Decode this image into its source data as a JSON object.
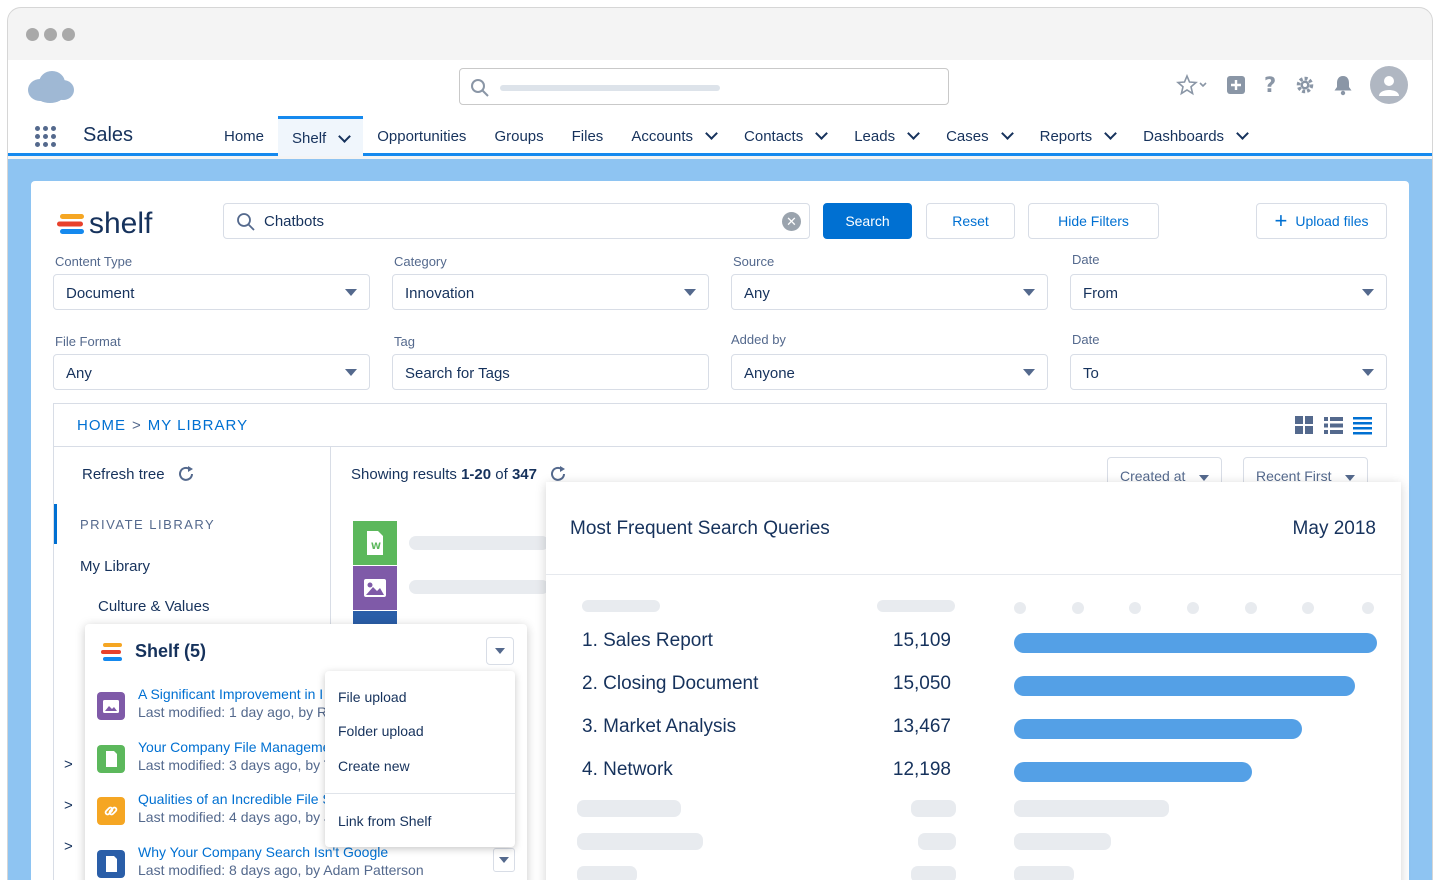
{
  "header": {
    "app_name": "Sales"
  },
  "nav": {
    "items": [
      {
        "label": "Home",
        "dropdown": false,
        "active": false
      },
      {
        "label": "Shelf",
        "dropdown": true,
        "active": true
      },
      {
        "label": "Opportunities",
        "dropdown": false,
        "active": false
      },
      {
        "label": "Groups",
        "dropdown": false,
        "active": false
      },
      {
        "label": "Files",
        "dropdown": false,
        "active": false
      },
      {
        "label": "Accounts",
        "dropdown": true,
        "active": false
      },
      {
        "label": "Contacts",
        "dropdown": true,
        "active": false
      },
      {
        "label": "Leads",
        "dropdown": true,
        "active": false
      },
      {
        "label": "Cases",
        "dropdown": true,
        "active": false
      },
      {
        "label": "Reports",
        "dropdown": true,
        "active": false
      },
      {
        "label": "Dashboards",
        "dropdown": true,
        "active": false
      }
    ]
  },
  "shelf": {
    "logo_text": "shelf",
    "search_value": "Chatbots",
    "search_button": "Search",
    "reset_button": "Reset",
    "hide_filters_button": "Hide Filters",
    "upload_button": "Upload files"
  },
  "filters": {
    "content_type": {
      "label": "Content Type",
      "value": "Document"
    },
    "category": {
      "label": "Category",
      "value": "Innovation"
    },
    "source": {
      "label": "Source",
      "value": "Any"
    },
    "date_from": {
      "label": "Date",
      "value": "From"
    },
    "file_format": {
      "label": "File Format",
      "value": "Any"
    },
    "tag": {
      "label": "Tag",
      "placeholder": "Search for Tags"
    },
    "added_by": {
      "label": "Added by",
      "value": "Anyone"
    },
    "date_to": {
      "label": "Date",
      "value": "To"
    }
  },
  "breadcrumb": {
    "home": "HOME",
    "separator": ">",
    "current": "MY LIBRARY"
  },
  "tree": {
    "refresh": "Refresh tree",
    "section": "PRIVATE LIBRARY",
    "my_library": "My Library",
    "culture": "Culture & Values"
  },
  "results": {
    "showing_prefix": "Showing results ",
    "range": "1-20",
    "of_text": " of ",
    "total": "347",
    "sort_field": "Created at",
    "sort_order": "Recent First"
  },
  "stats": {
    "title": "Most Frequent Search Queries",
    "date": "May 2018",
    "max": 16000,
    "rows": [
      {
        "label": "1. Sales Report",
        "value": "15,109",
        "num": 15109
      },
      {
        "label": "2. Closing Document",
        "value": "15,050",
        "num": 14200
      },
      {
        "label": "3. Market Analysis",
        "value": "13,467",
        "num": 12000
      },
      {
        "label": "4. Network",
        "value": "12,198",
        "num": 9900
      }
    ]
  },
  "shelf_popup": {
    "title": "Shelf (5)",
    "items": [
      {
        "title": "A Significant Improvement in I",
        "sub": "Last modified: 1 day ago, by Re",
        "color": "#7f5aa8",
        "icon": "image-icon"
      },
      {
        "title": "Your Company File Manageme",
        "sub": "Last modified: 3 days ago, by T",
        "color": "#5cb85c",
        "icon": "document-icon"
      },
      {
        "title": "Qualities of an Incredible File S",
        "sub": "Last modified: 4 days ago, by J",
        "color": "#f5a623",
        "icon": "link-icon"
      },
      {
        "title": "Why Your Company Search Isn't Google",
        "sub": "Last modified: 8 days ago, by Adam Patterson",
        "color": "#2a5ea8",
        "icon": "file-icon"
      }
    ]
  },
  "upload_menu": {
    "items": [
      "File upload",
      "Folder upload",
      "Create new",
      "Link from Shelf"
    ]
  },
  "colors": {
    "brand_blue": "#0070d2",
    "page_blue": "#8ec4f2",
    "bar_blue": "#54a0e6",
    "shelf_red": "#e8412c",
    "shelf_orange": "#f5a623",
    "shelf_blue": "#1589ee"
  }
}
